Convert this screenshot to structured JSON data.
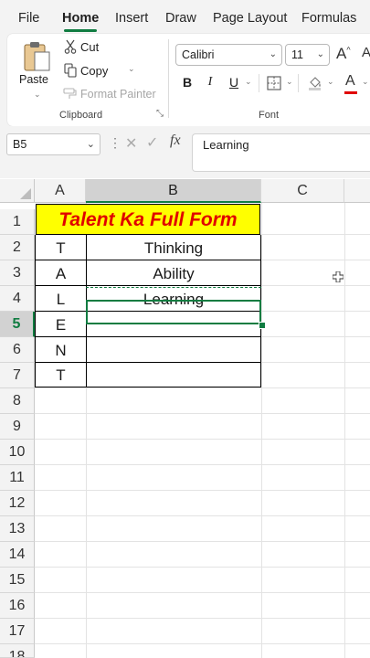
{
  "tabs": [
    "File",
    "Home",
    "Insert",
    "Draw",
    "Page Layout",
    "Formulas"
  ],
  "clipboard": {
    "paste_label": "Paste",
    "cut_label": "Cut",
    "copy_label": "Copy",
    "format_painter_label": "Format Painter",
    "group_label": "Clipboard"
  },
  "font": {
    "family": "Calibri",
    "size": "11",
    "group_label": "Font",
    "bold": "B",
    "italic": "I",
    "underline": "U",
    "grow": "A",
    "font_color_glyph": "A"
  },
  "formula_bar": {
    "name_box": "B5",
    "fx": "fx",
    "value": "Learning"
  },
  "columns": [
    "A",
    "B",
    "C"
  ],
  "rows": [
    "1",
    "2",
    "3",
    "4",
    "5",
    "6",
    "7",
    "8",
    "9",
    "10",
    "11",
    "12",
    "13",
    "14",
    "15",
    "16",
    "17",
    "18"
  ],
  "sheet": {
    "title": "Talent Ka Full Form",
    "col_a": [
      "T",
      "A",
      "L",
      "E",
      "N",
      "T"
    ],
    "col_b": [
      "Thinking",
      "Ability",
      "Learning",
      "",
      "",
      ""
    ]
  },
  "colors": {
    "accent": "#107c41",
    "title_fill": "#ffff00",
    "title_text": "#e00000"
  }
}
